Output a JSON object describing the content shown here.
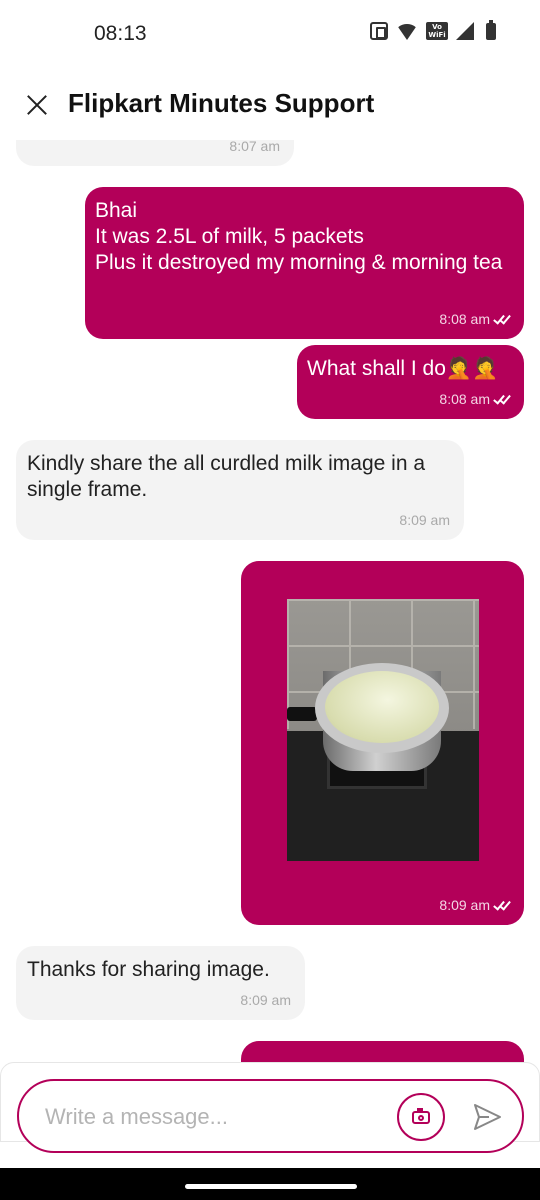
{
  "status_bar": {
    "time": "08:13",
    "icons": [
      "nfc-icon",
      "wifi-icon",
      "vowifi-icon",
      "signal-icon",
      "battery-icon"
    ],
    "vowifi_label": "Vo WiFi"
  },
  "header": {
    "title": "Flipkart Minutes Support"
  },
  "messages": [
    {
      "direction": "incoming",
      "text": "",
      "time": "8:07 am"
    },
    {
      "direction": "outgoing",
      "text": "Bhai\nIt was 2.5L of milk, 5 packets\nPlus it destroyed my morning & morning tea",
      "time": "8:08 am",
      "read": true
    },
    {
      "direction": "outgoing",
      "text": "What shall I do🤦🤦",
      "time": "8:08 am",
      "read": true
    },
    {
      "direction": "incoming",
      "text": "Kindly share the all curdled milk image in a single frame.",
      "time": "8:09 am"
    },
    {
      "direction": "outgoing",
      "type": "image",
      "time": "8:09 am",
      "read": true
    },
    {
      "direction": "incoming",
      "text": "Thanks for sharing image.",
      "time": "8:09 am"
    }
  ],
  "composer": {
    "placeholder": "Write a message..."
  },
  "colors": {
    "accent": "#b30059",
    "incoming_bubble": "#f3f3f3",
    "outgoing_bubble": "#b30059"
  }
}
